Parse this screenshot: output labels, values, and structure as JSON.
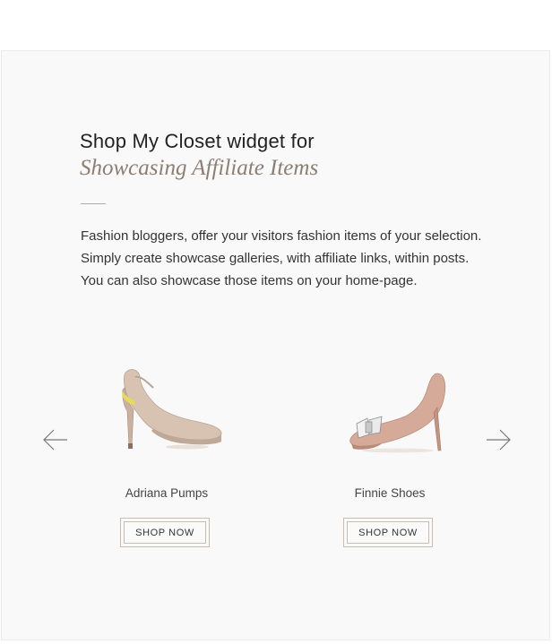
{
  "section": {
    "heading": "Shop My Closet widget for",
    "subheading": "Showcasing Affiliate Items",
    "description_lines": [
      "Fashion bloggers, offer your visitors fashion items of your selection.",
      "Simply create showcase galleries, with affiliate links, within posts.",
      "You can also showcase those items on your home-page."
    ]
  },
  "carousel": {
    "prev_icon": "arrow-left-icon",
    "next_icon": "arrow-right-icon",
    "products": [
      {
        "name": "Adriana Pumps",
        "button_label": "SHOP NOW",
        "image": "slingback-pump-shoe"
      },
      {
        "name": "Finnie Shoes",
        "button_label": "SHOP NOW",
        "image": "bow-pump-shoe"
      }
    ]
  },
  "colors": {
    "panel_bg": "#f9f9f9",
    "accent": "#8c7e72",
    "button_border": "#c9bdb0",
    "text": "#333333"
  }
}
